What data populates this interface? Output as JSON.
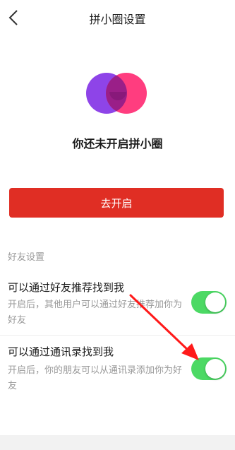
{
  "header": {
    "title": "拼小圈设置",
    "back_icon": "chevron-left-icon"
  },
  "logo": {
    "icon": "pinxiaoquan-logo",
    "colors": {
      "left_circle": "#8e44e8",
      "right_circle": "#ff3d7f",
      "overlap": "#9a1f88"
    }
  },
  "status": {
    "text": "你还未开启拼小圈"
  },
  "open_button": {
    "label": "去开启",
    "color": "#e02e24"
  },
  "friend_settings": {
    "section_label": "好友设置",
    "items": [
      {
        "title": "可以通过好友推荐找到我",
        "description": "开启后，其他用户可以通过好友推荐加你为好友",
        "enabled": true
      },
      {
        "title": "可以通过通讯录找到我",
        "description": "开启后，你的朋友可以从通讯录添加你为好友",
        "enabled": true
      }
    ]
  },
  "toggle_color": "#4cd964",
  "annotation_arrow_color": "#ff1a1a"
}
